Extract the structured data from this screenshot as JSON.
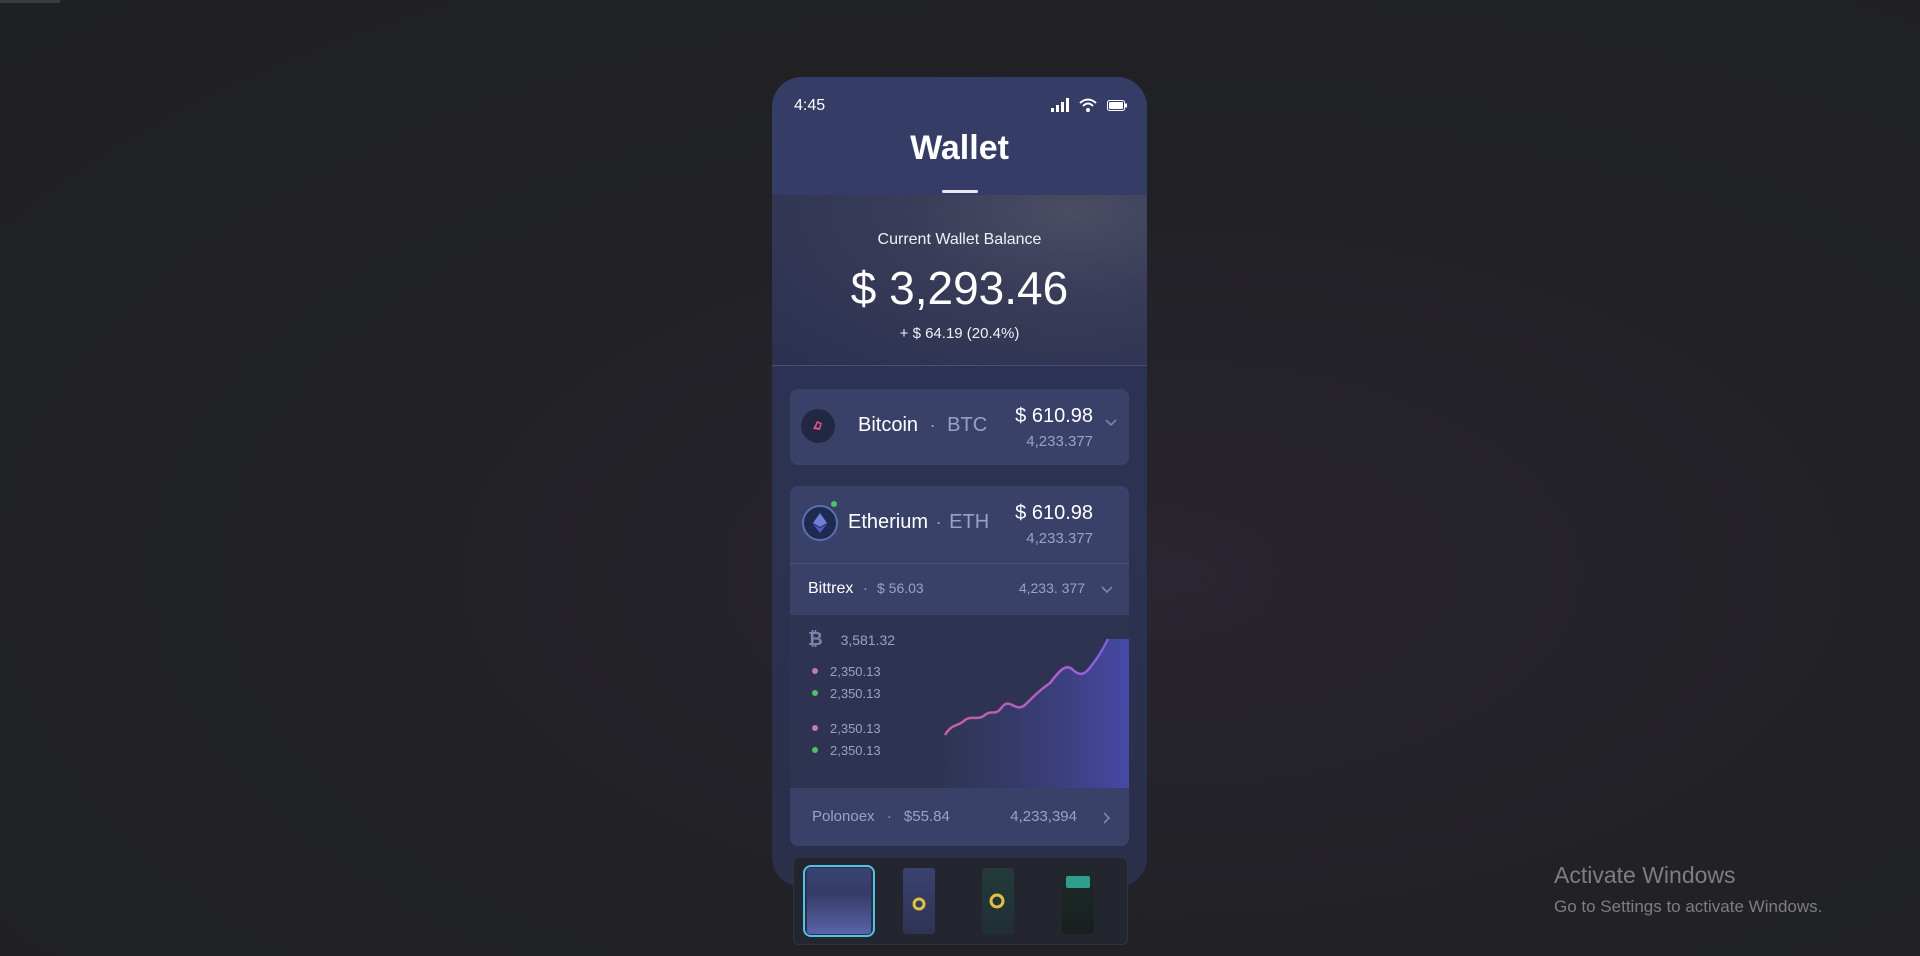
{
  "status": {
    "time": "4:45"
  },
  "header": {
    "title": "Wallet"
  },
  "balance": {
    "label": "Current Wallet Balance",
    "amount": "$ 3,293.46",
    "change": "+ $ 64.19 (20.4%)"
  },
  "coins": [
    {
      "name": "Bitcoin",
      "separator": "·",
      "symbol": "BTC",
      "value": "$ 610.98",
      "quantity": "4,233.377"
    },
    {
      "name": "Etherium",
      "separator": "·",
      "symbol": "ETH",
      "value": "$ 610.98",
      "quantity": "4,233.377"
    }
  ],
  "exchanges": {
    "bittrex": {
      "name": "Bittrex",
      "separator": "·",
      "value": "$ 56.03",
      "quantity": "4,233. 377"
    },
    "polonoex": {
      "name": "Polonoex",
      "separator": "·",
      "value": "$55.84",
      "quantity": "4,233,394"
    }
  },
  "chart": {
    "top_value": "3,581.32",
    "legend": [
      {
        "value": "2,350.13",
        "color": "#c07ab8"
      },
      {
        "value": "2,350.13",
        "color": "#4fbf6a"
      },
      {
        "value": "2,350.13",
        "color": "#c07ab8"
      },
      {
        "value": "2,350.13",
        "color": "#4fbf6a"
      }
    ]
  },
  "colors": {
    "accent": "#4fc3e8",
    "line": "#c45fd0",
    "fill": "#4a4bb0"
  },
  "windows_notice": {
    "title": "Activate Windows",
    "subtitle": "Go to Settings to activate Windows."
  }
}
